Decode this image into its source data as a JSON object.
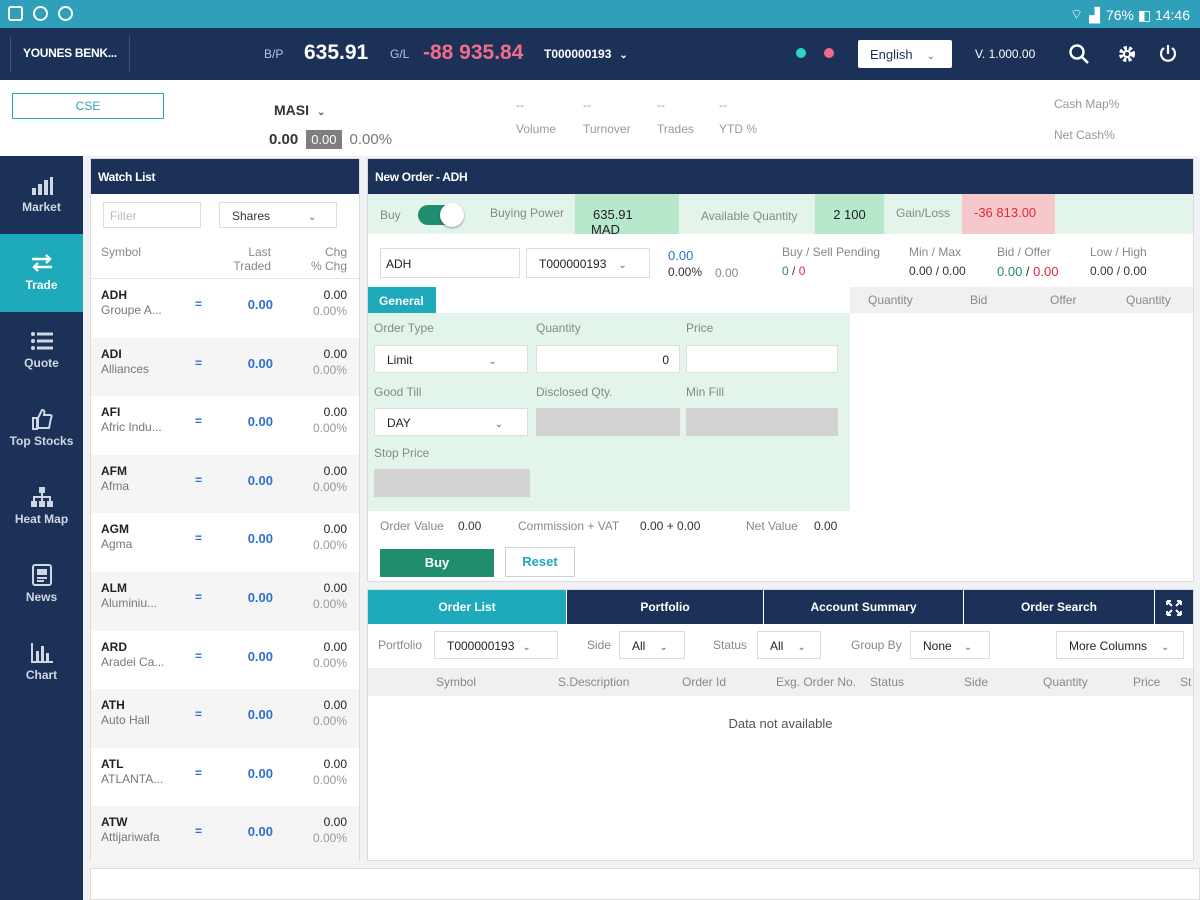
{
  "status_bar": {
    "right_text": "76% ◧ 14:46"
  },
  "header": {
    "user": "YOUNES BENK...",
    "bp_label": "B/P",
    "bp_value": "635.91",
    "gl_label": "G/L",
    "gl_value": "-88 935.84",
    "account": "T000000193",
    "language": "English",
    "version": "V. 1.000.00",
    "colors": {
      "dot1": "#2ed6c0",
      "dot2": "#f26b8a",
      "gl": "#f26b8a"
    }
  },
  "market": {
    "exchange": "CSE",
    "index": "MASI",
    "index_value": "0.00",
    "index_change": "0.00",
    "index_pct": "0.00%",
    "stats": [
      {
        "value": "--",
        "label": "Volume"
      },
      {
        "value": "--",
        "label": "Turnover"
      },
      {
        "value": "--",
        "label": "Trades"
      },
      {
        "value": "--",
        "label": "YTD %"
      }
    ],
    "cash_map": "Cash Map%",
    "net_cash": "Net Cash%"
  },
  "nav": [
    {
      "label": "Market",
      "icon": "market-chart-icon"
    },
    {
      "label": "Trade",
      "icon": "trade-arrows-icon",
      "active": true
    },
    {
      "label": "Quote",
      "icon": "quote-list-icon"
    },
    {
      "label": "Top Stocks",
      "icon": "thumbs-up-icon"
    },
    {
      "label": "Heat Map",
      "icon": "heat-map-icon"
    },
    {
      "label": "News",
      "icon": "news-icon"
    },
    {
      "label": "Chart",
      "icon": "chart-icon"
    }
  ],
  "watch": {
    "title": "Watch List",
    "filter_placeholder": "Filter",
    "type": "Shares",
    "col_symbol": "Symbol",
    "col_last_1": "Last",
    "col_last_2": "Traded",
    "col_chg_1": "Chg",
    "col_chg_2": "% Chg",
    "rows": [
      {
        "symbol": "ADH",
        "name": "Groupe A...",
        "flag": "=",
        "last": "0.00",
        "chg": "0.00",
        "pct": "0.00%"
      },
      {
        "symbol": "ADI",
        "name": "Alliances",
        "flag": "=",
        "last": "0.00",
        "chg": "0.00",
        "pct": "0.00%"
      },
      {
        "symbol": "AFI",
        "name": "Afric Indu...",
        "flag": "=",
        "last": "0.00",
        "chg": "0.00",
        "pct": "0.00%"
      },
      {
        "symbol": "AFM",
        "name": "Afma",
        "flag": "=",
        "last": "0.00",
        "chg": "0.00",
        "pct": "0.00%"
      },
      {
        "symbol": "AGM",
        "name": "Agma",
        "flag": "=",
        "last": "0.00",
        "chg": "0.00",
        "pct": "0.00%"
      },
      {
        "symbol": "ALM",
        "name": "Aluminiu...",
        "flag": "=",
        "last": "0.00",
        "chg": "0.00",
        "pct": "0.00%"
      },
      {
        "symbol": "ARD",
        "name": "Aradei Ca...",
        "flag": "=",
        "last": "0.00",
        "chg": "0.00",
        "pct": "0.00%"
      },
      {
        "symbol": "ATH",
        "name": "Auto Hall",
        "flag": "=",
        "last": "0.00",
        "chg": "0.00",
        "pct": "0.00%"
      },
      {
        "symbol": "ATL",
        "name": "ATLANTA...",
        "flag": "=",
        "last": "0.00",
        "chg": "0.00",
        "pct": "0.00%"
      },
      {
        "symbol": "ATW",
        "name": "Attijariwafa",
        "flag": "=",
        "last": "0.00",
        "chg": "0.00",
        "pct": "0.00%"
      }
    ]
  },
  "order": {
    "title": "New Order - ADH",
    "side": "Buy",
    "buying_power_label": "Buying Power",
    "buying_power": "635.91",
    "currency": "MAD",
    "avail_label": "Available Quantity",
    "avail_qty": "2 100",
    "gain_label": "Gain/Loss",
    "gain": "-36 813.00",
    "symbol": "ADH",
    "account": "T000000193",
    "price": "0.00",
    "price_pct": "0.00%",
    "price_chg": "0.00",
    "pending_label": "Buy / Sell Pending",
    "pending_buy": "0",
    "pending_sep": " / ",
    "pending_sell": "0",
    "minmax_label": "Min / Max",
    "minmax": "0.00 / 0.00",
    "bidoffer_label": "Bid / Offer",
    "bid": "0.00",
    "bo_sep": " / ",
    "offer": "0.00",
    "lowhigh_label": "Low / High",
    "lowhigh": "0.00 / 0.00",
    "tab": "General",
    "book_cols": [
      "Quantity",
      "Bid",
      "Offer",
      "Quantity"
    ],
    "order_type_label": "Order Type",
    "order_type": "Limit",
    "quantity_label": "Quantity",
    "quantity": "0",
    "price_label": "Price",
    "price_value": "",
    "good_till_label": "Good Till",
    "good_till": "DAY",
    "disclosed_label": "Disclosed Qty.",
    "min_fill_label": "Min Fill",
    "stop_price_label": "Stop Price",
    "order_value_label": "Order Value",
    "order_value": "0.00",
    "commission_label": "Commission + VAT",
    "commission": "0.00 + 0.00",
    "net_value_label": "Net Value",
    "net_value": "0.00",
    "buy_button": "Buy",
    "reset_button": "Reset"
  },
  "bottom": {
    "tabs": [
      "Order List",
      "Portfolio",
      "Account Summary",
      "Order Search"
    ],
    "portfolio_label": "Portfolio",
    "portfolio": "T000000193",
    "side_label": "Side",
    "side": "All",
    "status_label": "Status",
    "status": "All",
    "group_label": "Group By",
    "group": "None",
    "more_columns": "More Columns",
    "cols": [
      "Symbol",
      "S.Description",
      "Order Id",
      "Exg. Order No.",
      "Status",
      "Side",
      "Quantity",
      "Price",
      "St"
    ],
    "empty": "Data not available"
  }
}
